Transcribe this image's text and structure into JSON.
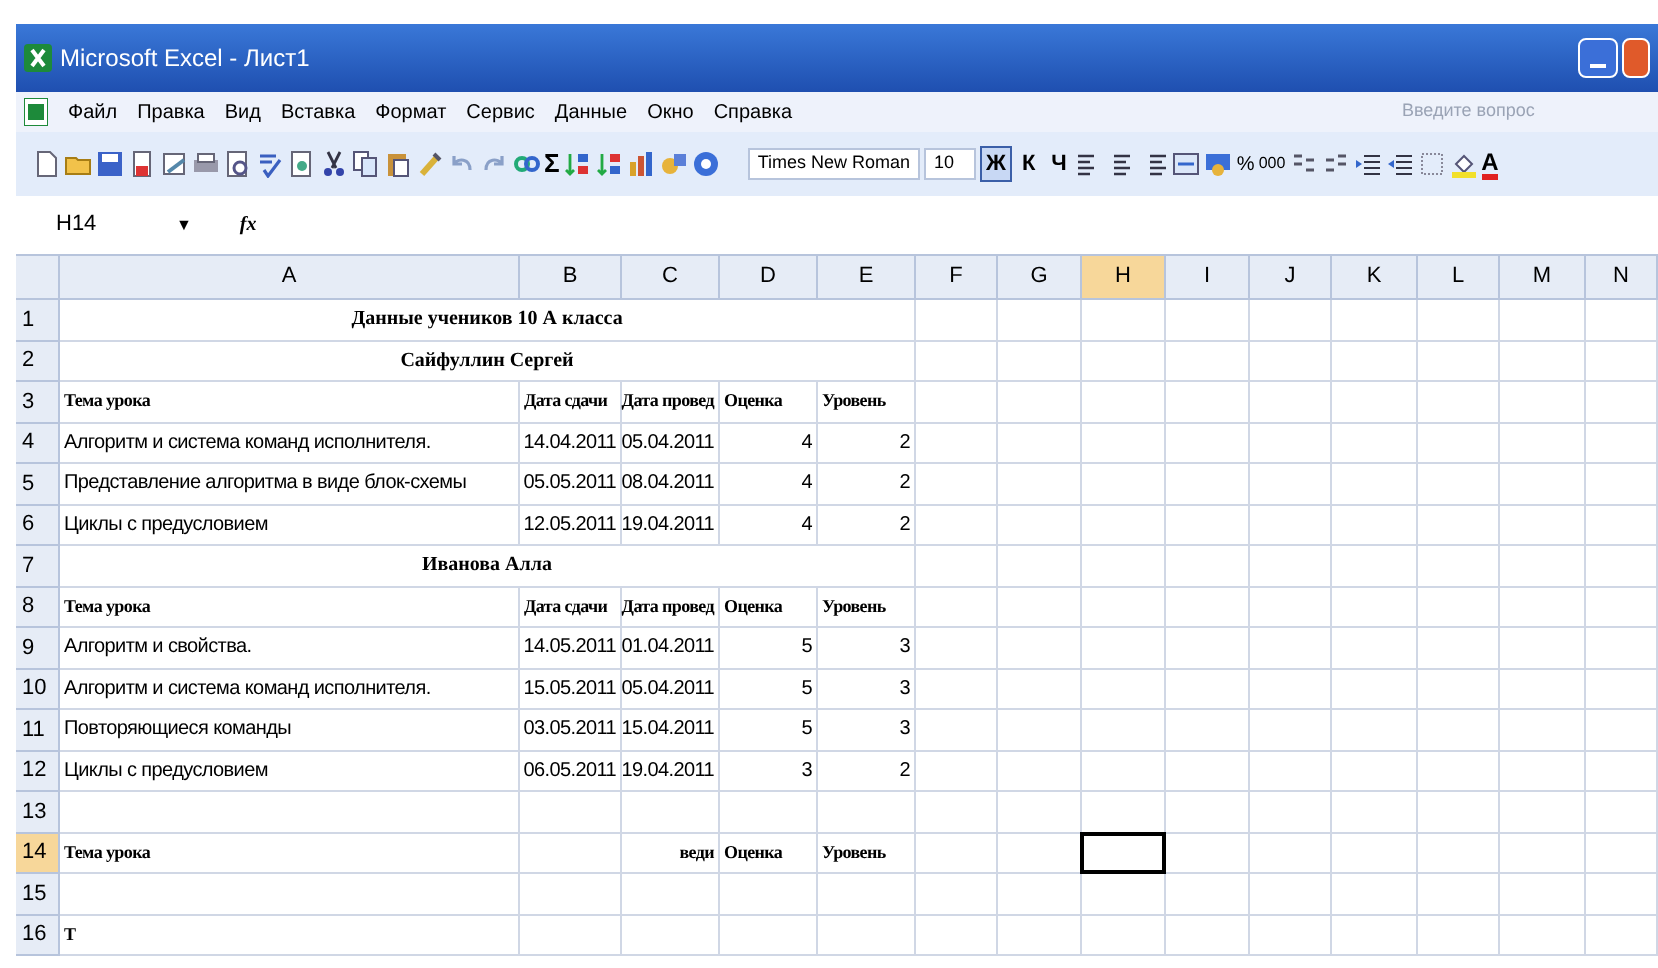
{
  "window": {
    "title": "Microsoft Excel - Лист1"
  },
  "menu": {
    "items": [
      "Файл",
      "Правка",
      "Вид",
      "Вставка",
      "Формат",
      "Сервис",
      "Данные",
      "Окно",
      "Справка"
    ],
    "help_placeholder": "Введите вопрос"
  },
  "standard_toolbar": {
    "sum": "Σ"
  },
  "formatting_toolbar": {
    "font": "Times New Roman",
    "size": "10",
    "style_buttons": [
      {
        "label": "Ж",
        "pressed": true
      },
      {
        "label": "К",
        "pressed": false
      },
      {
        "label": "Ч",
        "pressed": false
      }
    ],
    "percent": "%",
    "thousands": "000",
    "font_color": "A"
  },
  "formula_bar": {
    "name_box": "H14",
    "arrow": "▼",
    "fx": "fx"
  },
  "columns": [
    {
      "label": "A",
      "selected": false
    },
    {
      "label": "B",
      "selected": false
    },
    {
      "label": "C",
      "selected": false
    },
    {
      "label": "D",
      "selected": false
    },
    {
      "label": "E",
      "selected": false
    },
    {
      "label": "F",
      "selected": false
    },
    {
      "label": "G",
      "selected": false
    },
    {
      "label": "H",
      "selected": true
    },
    {
      "label": "I",
      "selected": false
    },
    {
      "label": "J",
      "selected": false
    },
    {
      "label": "K",
      "selected": false
    },
    {
      "label": "L",
      "selected": false
    },
    {
      "label": "M",
      "selected": false
    },
    {
      "label": "N",
      "selected": false
    }
  ],
  "rows": [
    {
      "number": "1",
      "kind": "title",
      "selected": false,
      "text": "Данные учеников 10  А класса"
    },
    {
      "number": "2",
      "kind": "title",
      "selected": false,
      "text": "Сайфуллин Сергей"
    },
    {
      "number": "3",
      "kind": "header",
      "selected": false,
      "cells": [
        "Тема урока",
        "Дата сдачи",
        "Дата провед",
        "Оценка",
        "Уровень"
      ]
    },
    {
      "number": "4",
      "kind": "data",
      "selected": false,
      "cells": [
        "Алгоритм и система команд исполнителя.",
        "14.04.2011",
        "05.04.2011",
        "4",
        "2"
      ]
    },
    {
      "number": "5",
      "kind": "data",
      "selected": false,
      "cells": [
        "Представление алгоритма в виде блок-схемы",
        "05.05.2011",
        "08.04.2011",
        "4",
        "2"
      ]
    },
    {
      "number": "6",
      "kind": "data",
      "selected": false,
      "cells": [
        "Циклы с предусловием",
        "12.05.2011",
        "19.04.2011",
        "4",
        "2"
      ]
    },
    {
      "number": "7",
      "kind": "title",
      "selected": false,
      "text": "Иванова Алла"
    },
    {
      "number": "8",
      "kind": "header",
      "selected": false,
      "cells": [
        "Тема урока",
        "Дата сдачи",
        "Дата провед",
        "Оценка",
        "Уровень"
      ]
    },
    {
      "number": "9",
      "kind": "data",
      "selected": false,
      "cells": [
        "Алгоритм и свойства.",
        "14.05.2011",
        "01.04.2011",
        "5",
        "3"
      ]
    },
    {
      "number": "10",
      "kind": "data",
      "selected": false,
      "cells": [
        "Алгоритм и система команд исполнителя.",
        "15.05.2011",
        "05.04.2011",
        "5",
        "3"
      ]
    },
    {
      "number": "11",
      "kind": "data",
      "selected": false,
      "cells": [
        "Повторяющиеся команды",
        "03.05.2011",
        "15.04.2011",
        "5",
        "3"
      ]
    },
    {
      "number": "12",
      "kind": "data",
      "selected": false,
      "cells": [
        "Циклы с предусловием",
        "06.05.2011",
        "19.04.2011",
        "3",
        "2"
      ]
    },
    {
      "number": "13",
      "kind": "empty",
      "selected": false
    },
    {
      "number": "14",
      "kind": "header",
      "selected": true,
      "cells": [
        "Тема урока",
        "",
        "веди",
        "Оценка",
        "Уровень"
      ]
    },
    {
      "number": "15",
      "kind": "empty",
      "selected": false
    },
    {
      "number": "16",
      "kind": "header",
      "selected": false,
      "cells": [
        "Т"
      ]
    }
  ]
}
